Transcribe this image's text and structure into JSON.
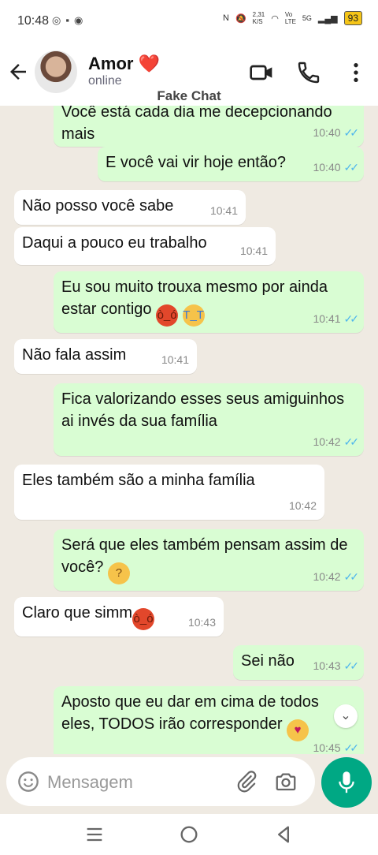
{
  "status_bar": {
    "time": "10:48",
    "speed": "2,31\nK/S",
    "network": "Vo\nLTE",
    "signal": "5G",
    "battery": "93"
  },
  "header": {
    "contact_name": "Amor ❤️",
    "contact_status": "online"
  },
  "watermark": "Fake Chat",
  "messages": [
    {
      "text": "Você está cada dia me decepcionando mais",
      "time": "10:40",
      "direction": "out",
      "read": true
    },
    {
      "text": "E você vai vir hoje então?",
      "time": "10:40",
      "direction": "out",
      "read": true
    },
    {
      "text": "Não posso você sabe",
      "time": "10:41",
      "direction": "in"
    },
    {
      "text": "Daqui a pouco eu trabalho",
      "time": "10:41",
      "direction": "in"
    },
    {
      "text": "Eu sou muito trouxa mesmo por ainda estar contigo",
      "time": "10:41",
      "direction": "out",
      "read": true
    },
    {
      "text": "Não fala assim",
      "time": "10:41",
      "direction": "in"
    },
    {
      "text": "Fica valorizando esses seus amiguinhos ai invés da sua família",
      "time": "10:42",
      "direction": "out",
      "read": true
    },
    {
      "text": "Eles também são a minha família",
      "time": "10:42",
      "direction": "in"
    },
    {
      "text": "Será que eles também pensam assim de você?",
      "time": "10:42",
      "direction": "out",
      "read": true
    },
    {
      "text": "Claro que simm",
      "time": "10:43",
      "direction": "in"
    },
    {
      "text": "Sei não",
      "time": "10:43",
      "direction": "out",
      "read": true
    },
    {
      "text": "Aposto que eu dar em cima de todos eles, TODOS irão corresponder",
      "time": "10:45",
      "direction": "out",
      "read": true
    }
  ],
  "input": {
    "placeholder": "Mensagem"
  },
  "colors": {
    "accent": "#00a884",
    "outgoing_bubble": "#d9fdd3",
    "chat_background": "#efeae2",
    "read_check": "#4fb6ec"
  }
}
